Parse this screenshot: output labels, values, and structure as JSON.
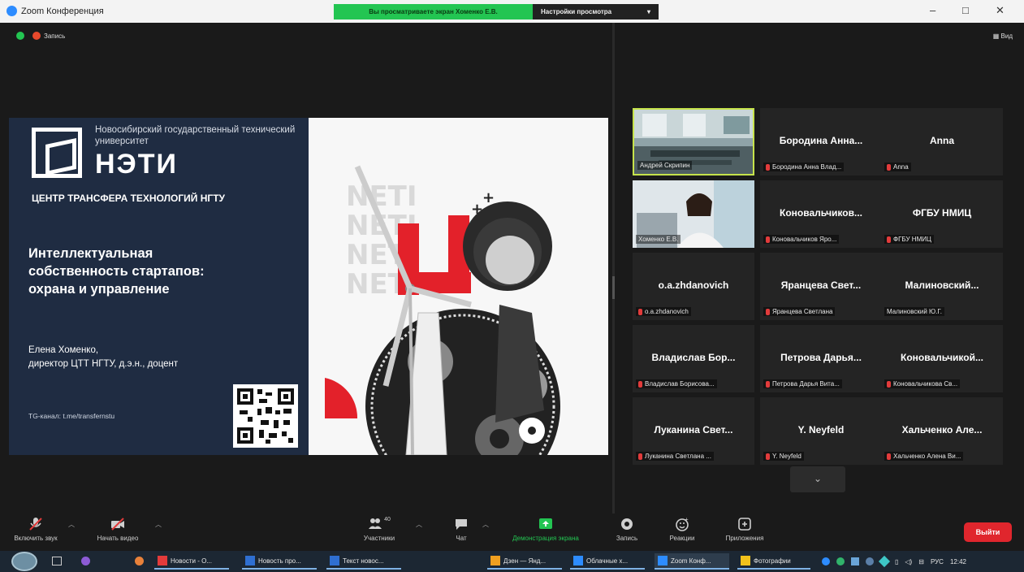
{
  "window": {
    "title": "Zoom Конференция",
    "sharing_banner": "Вы просматриваете экран Хоменко Е.В.",
    "view_options": "Настройки просмотра",
    "minimize": "–",
    "maximize": "□",
    "close": "✕"
  },
  "meeting": {
    "recording_label": "Запись",
    "view_label": "Вид"
  },
  "slide": {
    "university": "Новосибирский государственный технический университет",
    "logo_text": "НЭТИ",
    "center": "ЦЕНТР ТРАНСФЕРА ТЕХНОЛОГИЙ НГТУ",
    "talk_title_1": "Интеллектуальная",
    "talk_title_2": "собственность стартапов:",
    "talk_title_3": "охрана и управление",
    "author_name": "Елена Хоменко,",
    "author_role": "директор ЦТТ НГТУ, д.э.н., доцент",
    "tg": "TG-канал: t.me/transfernstu",
    "art_words": [
      "NETI",
      "NETI",
      "NETI",
      "NETI"
    ]
  },
  "participants": [
    {
      "name": "",
      "label": "Андрей Скрипин",
      "video": true,
      "muted": false
    },
    {
      "name": "Бородина Анна...",
      "label": "Бородина Анна Влад...",
      "video": false,
      "muted": true
    },
    {
      "name": "Anna",
      "label": "Anna",
      "video": false,
      "muted": true
    },
    {
      "name": "",
      "label": "Хоменко Е.В.",
      "video": true,
      "muted": false
    },
    {
      "name": "Коновальчиков...",
      "label": "Коновальчиков Яро...",
      "video": false,
      "muted": true
    },
    {
      "name": "ФГБУ НМИЦ",
      "label": "ФГБУ НМИЦ",
      "video": false,
      "muted": true
    },
    {
      "name": "o.a.zhdanovich",
      "label": "o.a.zhdanovich",
      "video": false,
      "muted": true
    },
    {
      "name": "Яранцева Свет...",
      "label": "Яранцева Светлана",
      "video": false,
      "muted": true
    },
    {
      "name": "Малиновский...",
      "label": "Малиновский Ю.Г.",
      "video": false,
      "muted": false
    },
    {
      "name": "Владислав Бор...",
      "label": "Владислав Борисова...",
      "video": false,
      "muted": true
    },
    {
      "name": "Петрова Дарья...",
      "label": "Петрова Дарья Вита...",
      "video": false,
      "muted": true
    },
    {
      "name": "Коновальчикой...",
      "label": "Коновальчикова Св...",
      "video": false,
      "muted": true
    },
    {
      "name": "Луканина Свет...",
      "label": "Луканина Светлана ...",
      "video": false,
      "muted": true
    },
    {
      "name": "Y. Neyfeld",
      "label": "Y. Neyfeld",
      "video": false,
      "muted": true
    },
    {
      "name": "Хальченко Але...",
      "label": "Хальченко Алена Ви...",
      "video": false,
      "muted": true
    }
  ],
  "toolbar": {
    "unmute": "Включить звук",
    "start_video": "Начать видео",
    "participants": "Участники",
    "participants_count": "40",
    "chat": "Чат",
    "share": "Демонстрация экрана",
    "record": "Запись",
    "reactions": "Реакции",
    "apps": "Приложения",
    "leave": "Выйти"
  },
  "taskbar": {
    "tasks": [
      "Новости - O...",
      "Новость про...",
      "Текст новос...",
      "Дзен — Янд...",
      "Облачные х...",
      "Zoom Конф...",
      "Фотографии"
    ],
    "lang": "РУС",
    "time": "12:42"
  },
  "colors": {
    "accent_green": "#23c552",
    "leave_red": "#e0262d",
    "slide_navy": "#1f2c42",
    "active_speaker": "#c6e34b"
  }
}
